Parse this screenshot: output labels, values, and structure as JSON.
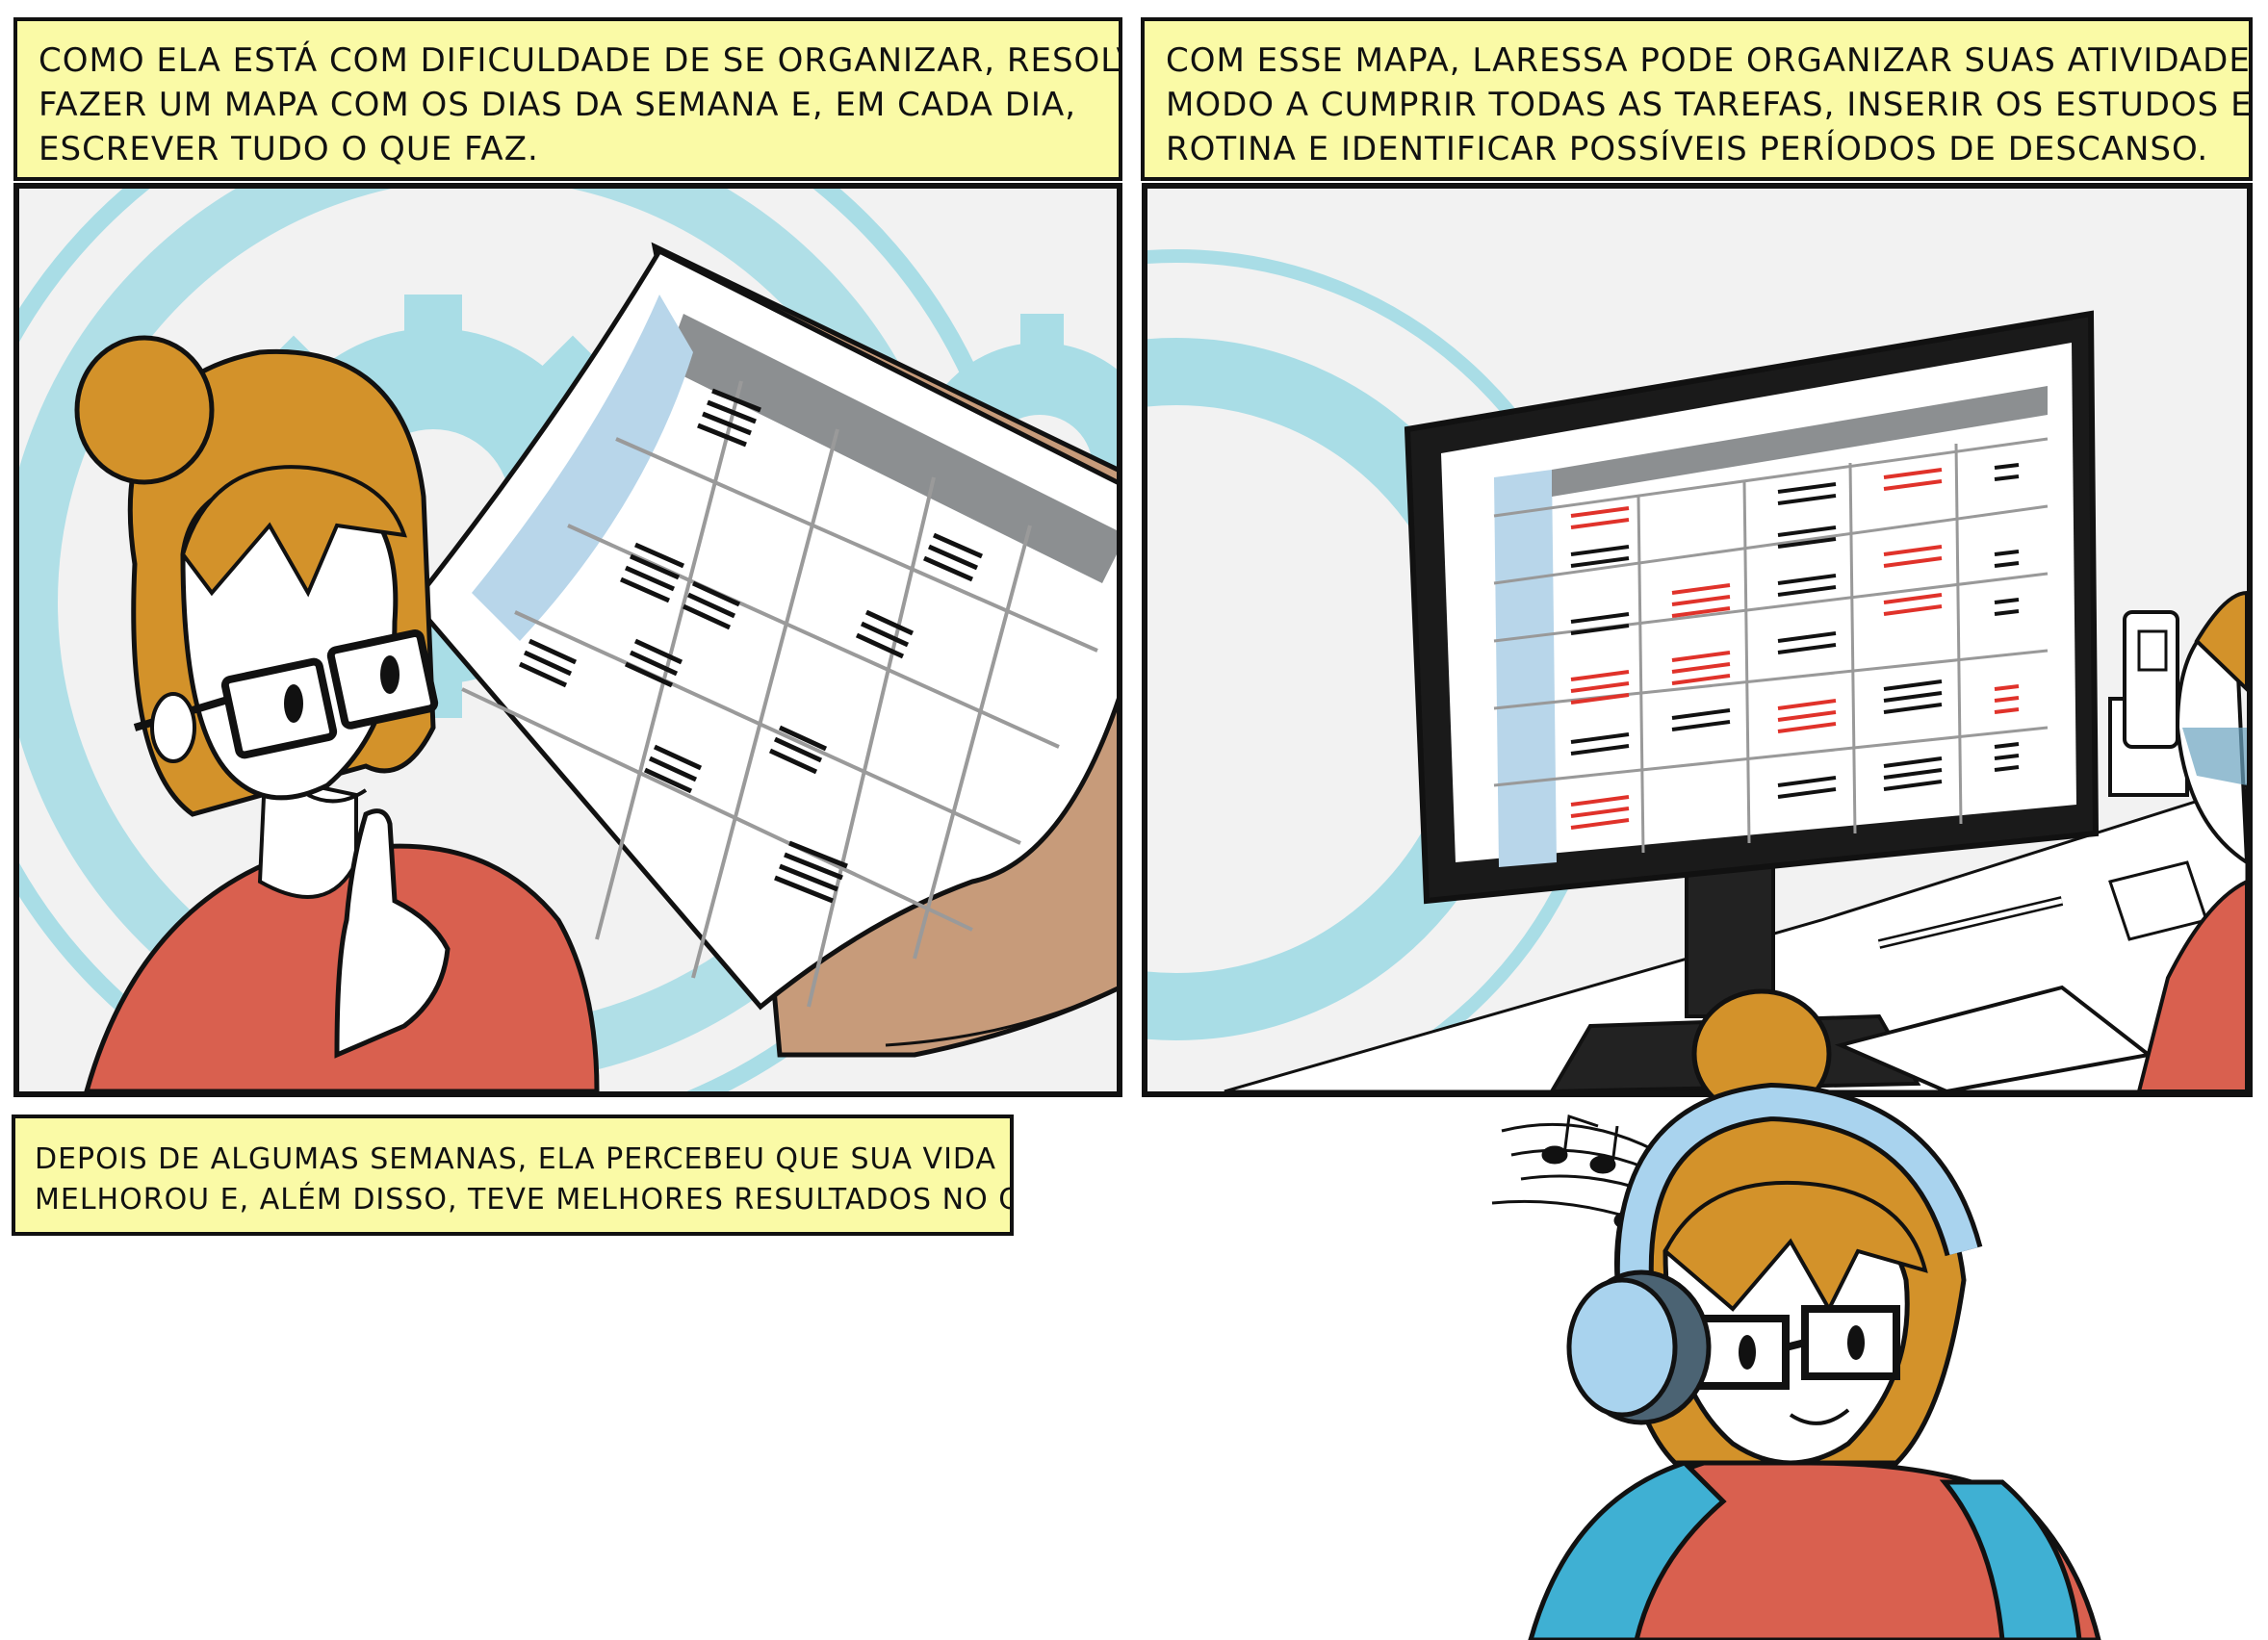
{
  "captions": {
    "first": [
      "Como ela está com dificuldade de se organizar, resolveu",
      "fazer um mapa com os dias da semana e, em cada dia,",
      "escrever tudo o que faz."
    ],
    "second": [
      "Com esse mapa, Laressa pode organizar suas atividades de",
      "modo a cumprir todas as tarefas, inserir os estudos em sua",
      "rotina e identificar possíveis períodos de descanso."
    ],
    "third": [
      "Depois de algumas semanas, ela percebeu que sua vida",
      "melhorou e, além disso, teve melhores resultados no curso."
    ]
  },
  "colors": {
    "caption_bg": "#fafaa6",
    "panel_bg": "#f2f2f2",
    "gear": "#a9dde6",
    "hair": "#d3922a",
    "shirt": "#d9604f",
    "skin": "#ffffff",
    "accent_red": "#e0322a",
    "headphones": "#a9d3ee",
    "backpack": "#3fb0d3"
  },
  "scenes": {
    "panel1": "woman-thinking-with-calendar",
    "panel2": "computer-monitor-with-weekly-schedule",
    "bottom": "woman-with-headphones-and-music-notes"
  }
}
